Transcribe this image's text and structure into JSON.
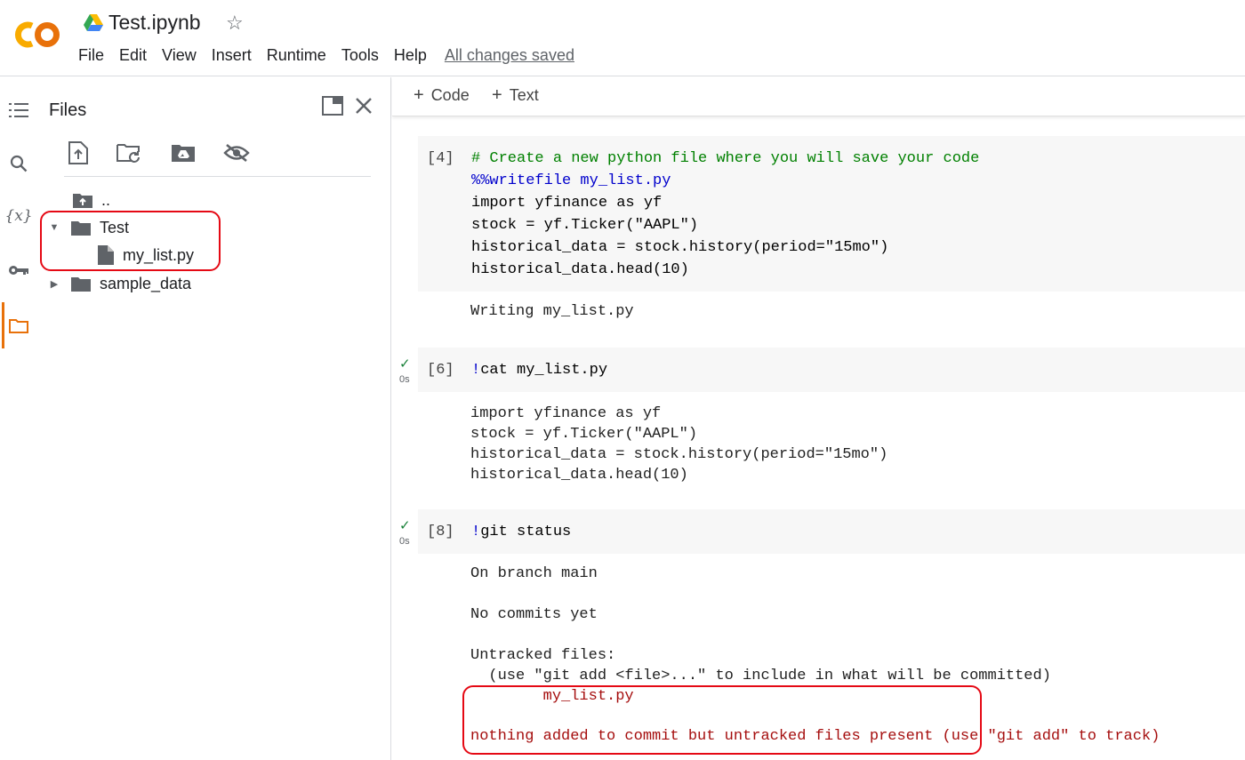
{
  "header": {
    "title": "Test.ipynb",
    "menu": [
      "File",
      "Edit",
      "View",
      "Insert",
      "Runtime",
      "Tools",
      "Help"
    ],
    "save_status": "All changes saved"
  },
  "colors": {
    "accent": "#e8710a",
    "logo_orange": "#f9ab00",
    "callout": "#e50914",
    "comment": "#008000",
    "magic": "#0000cc",
    "error": "#a50e0e"
  },
  "files_panel": {
    "title": "Files",
    "toolbar_icons": [
      "upload-file-icon",
      "refresh-folder-icon",
      "mount-drive-icon",
      "hide-files-icon"
    ],
    "tree": {
      "parent": "..",
      "folder_test": "Test",
      "file_my_list": "my_list.py",
      "folder_sample": "sample_data"
    }
  },
  "notebook": {
    "add_code": "Code",
    "add_text": "Text",
    "cells": {
      "c1": {
        "count": "[4]",
        "comment": "# Create a new python file where you will save your code",
        "magic": "%%writefile my_list.py",
        "line3": "import yfinance as yf",
        "line4": "stock = yf.Ticker(\"AAPL\")",
        "line5": "historical_data = stock.history(period=\"15mo\")",
        "line6": "historical_data.head(10)",
        "output": "Writing my_list.py"
      },
      "c2": {
        "count": "[6]",
        "time": "0s",
        "bang": "!",
        "code": "cat my_list.py",
        "out1": "import yfinance as yf",
        "out2": "stock = yf.Ticker(\"AAPL\")",
        "out3": "historical_data = stock.history(period=\"15mo\")",
        "out4": "historical_data.head(10)"
      },
      "c3": {
        "count": "[8]",
        "time": "0s",
        "bang": "!",
        "code": "git status",
        "out1": "On branch main",
        "out2": "No commits yet",
        "out3": "Untracked files:",
        "out4": "  (use \"git add <file>...\" to include in what will be committed)",
        "out5": "        my_list.py",
        "out6": "nothing added to commit but untracked files present",
        "out6b": " (use \"git add\" to track)"
      }
    }
  }
}
